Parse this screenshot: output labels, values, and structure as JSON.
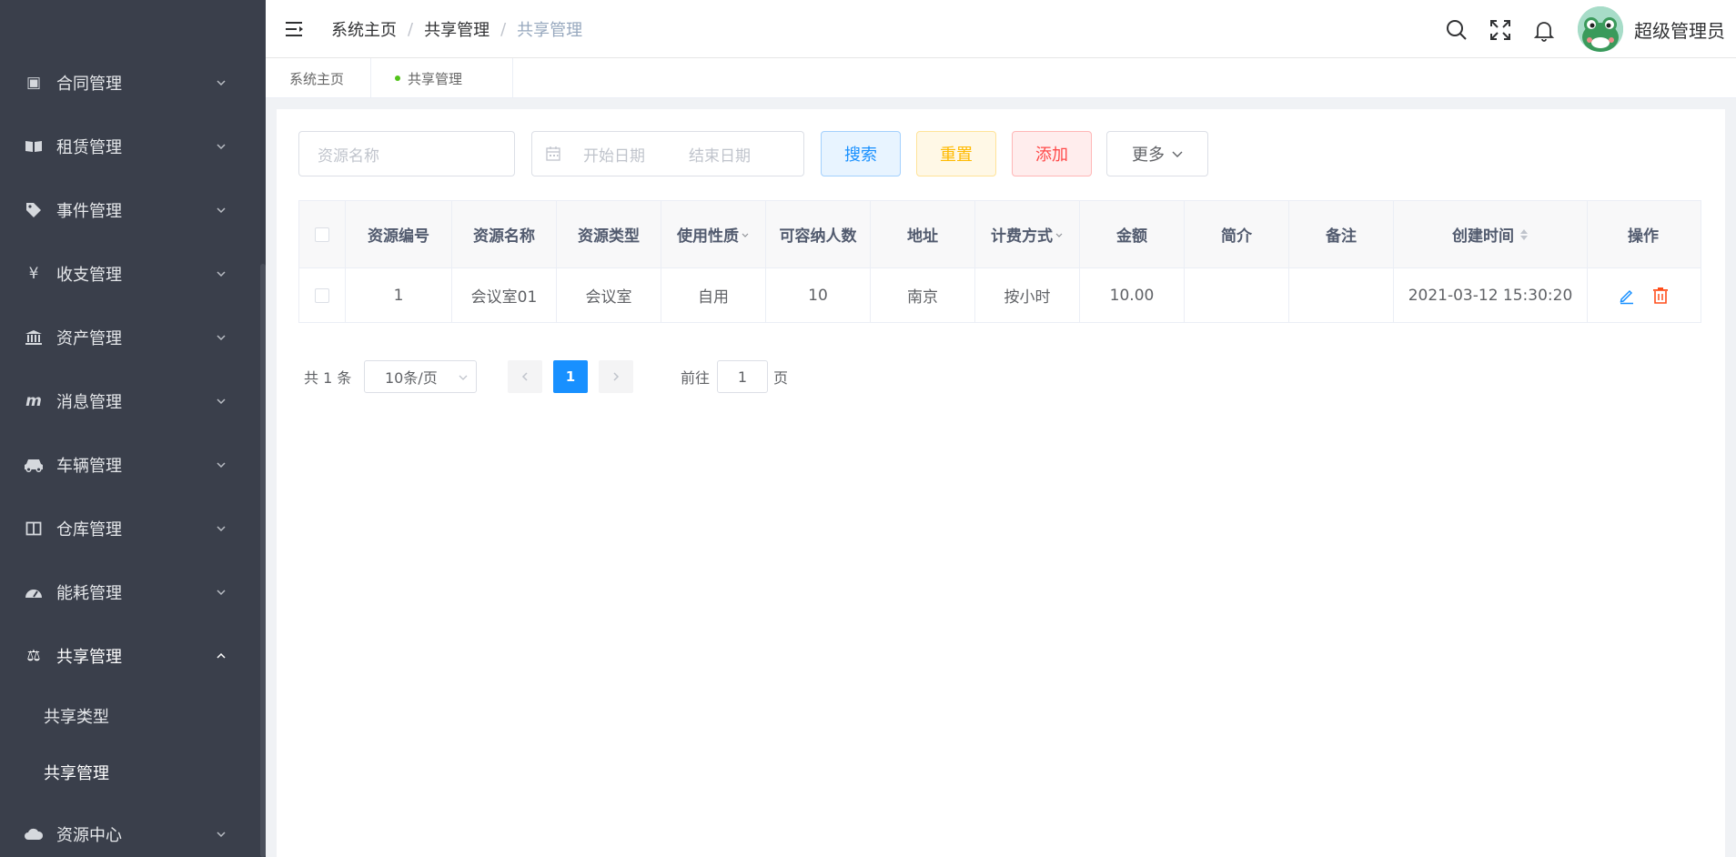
{
  "sidebar": {
    "items": [
      {
        "label": "合同管理",
        "icon": "contract-icon",
        "glyph": "▣"
      },
      {
        "label": "租赁管理",
        "icon": "book-icon",
        "glyph": "📖"
      },
      {
        "label": "事件管理",
        "icon": "tag-icon",
        "glyph": "◆"
      },
      {
        "label": "收支管理",
        "icon": "yen-icon",
        "glyph": "¥"
      },
      {
        "label": "资产管理",
        "icon": "bank-icon",
        "glyph": "🏛"
      },
      {
        "label": "消息管理",
        "icon": "message-icon",
        "glyph": "m"
      },
      {
        "label": "车辆管理",
        "icon": "car-icon",
        "glyph": "🚗"
      },
      {
        "label": "仓库管理",
        "icon": "warehouse-icon",
        "glyph": "◫"
      },
      {
        "label": "能耗管理",
        "icon": "dashboard-icon",
        "glyph": "◕"
      },
      {
        "label": "共享管理",
        "icon": "share-icon",
        "glyph": "⚖"
      }
    ],
    "submenu": [
      {
        "label": "共享类型"
      },
      {
        "label": "共享管理"
      }
    ],
    "last_item": {
      "label": "资源中心",
      "icon": "cloud-icon",
      "glyph": "☁"
    }
  },
  "header": {
    "breadcrumb": [
      "系统主页",
      "共享管理",
      "共享管理"
    ],
    "separator": "/",
    "username": "超级管理员"
  },
  "tags": [
    {
      "label": "系统主页"
    },
    {
      "label": "共享管理"
    }
  ],
  "search": {
    "name_placeholder": "资源名称",
    "start_date_placeholder": "开始日期",
    "end_date_placeholder": "结束日期",
    "search_label": "搜索",
    "reset_label": "重置",
    "add_label": "添加",
    "more_label": "更多"
  },
  "table": {
    "columns": [
      "资源编号",
      "资源名称",
      "资源类型",
      "使用性质",
      "可容纳人数",
      "地址",
      "计费方式",
      "金额",
      "简介",
      "备注",
      "创建时间",
      "操作"
    ],
    "rows": [
      [
        "1",
        "会议室01",
        "会议室",
        "自用",
        "10",
        "南京",
        "按小时",
        "10.00",
        "",
        "",
        "2021-03-12 15:30:20"
      ]
    ]
  },
  "pagination": {
    "total_text": "共 1 条",
    "page_size": "10条/页",
    "current_page": "1",
    "goto_prefix": "前往",
    "goto_value": "1",
    "goto_suffix": "页"
  },
  "colors": {
    "sidebar_bg": "#3a3f4b",
    "primary": "#1890ff",
    "warning": "#ffba00",
    "danger": "#ff4949",
    "edit_icon": "#1890ff",
    "delete_icon": "#ff4d1a"
  }
}
